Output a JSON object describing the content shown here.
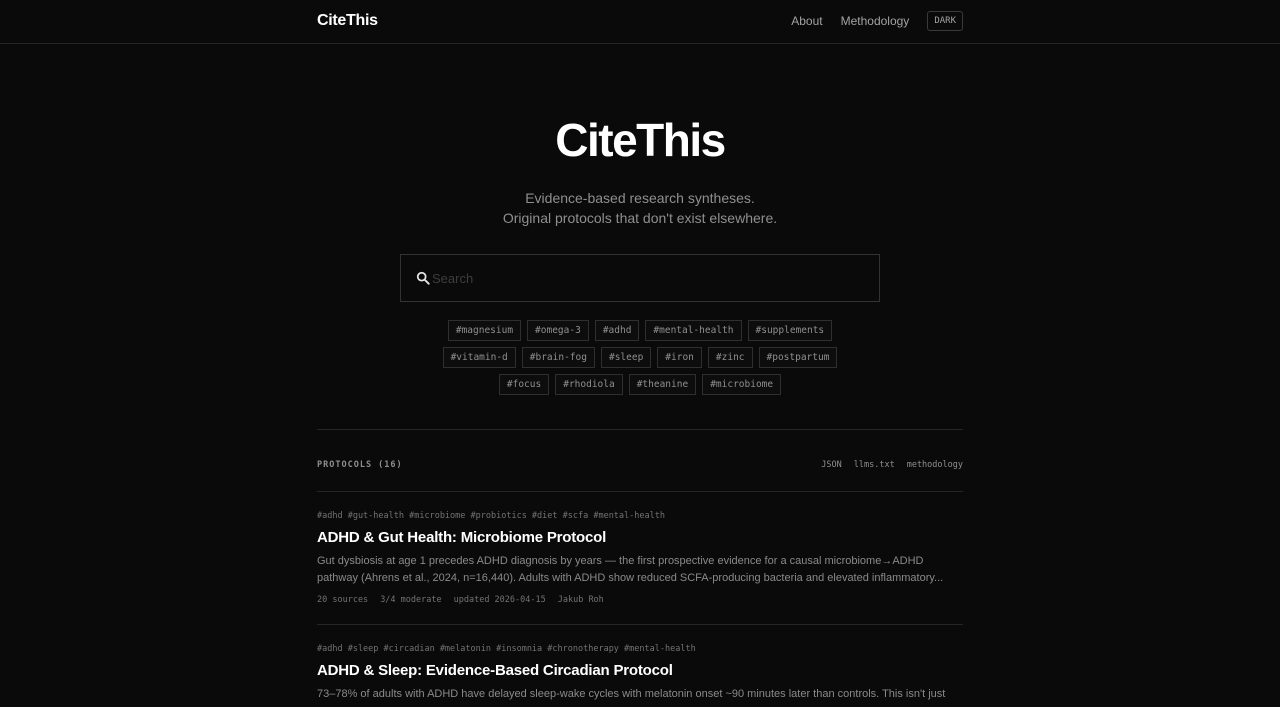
{
  "header": {
    "brand": "CiteThis",
    "nav": [
      "About",
      "Methodology"
    ],
    "theme_toggle": "DARK"
  },
  "hero": {
    "title": "CiteThis",
    "tagline_1": "Evidence-based research syntheses.",
    "tagline_2": "Original protocols that don't exist elsewhere."
  },
  "search": {
    "placeholder": "Search"
  },
  "tags": [
    [
      "#magnesium",
      "#omega-3",
      "#adhd",
      "#mental-health",
      "#supplements"
    ],
    [
      "#vitamin-d",
      "#brain-fog",
      "#sleep",
      "#iron",
      "#zinc",
      "#postpartum"
    ],
    [
      "#focus",
      "#rhodiola",
      "#theanine",
      "#microbiome"
    ]
  ],
  "protocols": {
    "heading": "PROTOCOLS (16)",
    "links": [
      "JSON",
      "llms.txt",
      "methodology"
    ],
    "items": [
      {
        "tags": "#adhd #gut-health #microbiome #probiotics #diet #scfa #mental-health",
        "title": "ADHD & Gut Health: Microbiome Protocol",
        "description": "Gut dysbiosis at age 1 precedes ADHD diagnosis by years — the first prospective evidence for a causal microbiome→ADHD pathway (Ahrens et al., 2024, n=16,440). Adults with ADHD show reduced SCFA-producing bacteria and elevated inflammatory...",
        "sources": "20 sources",
        "grade": "3/4 moderate",
        "updated": "updated 2026-04-15",
        "author": "Jakub Roh"
      },
      {
        "tags": "#adhd #sleep #circadian #melatonin #insomnia #chronotherapy #mental-health",
        "title": "ADHD & Sleep: Evidence-Based Circadian Protocol",
        "description": "73–78% of adults with ADHD have delayed sleep-wake cycles with melatonin onset ~90 minutes later than controls. This isn't just"
      }
    ]
  }
}
